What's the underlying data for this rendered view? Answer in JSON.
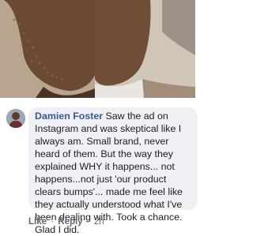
{
  "photo": {
    "before_alt": "",
    "after_alt": ""
  },
  "comment": {
    "author": "Damien Foster",
    "text": "Saw the ad on Instagram and was skeptical like I always am. Small brand, never heard of them. But the way they explained WHY it happens... not happens...not just 'our product clears bumps'... made me feel like they actually understood what I've been dealing with. Took a chance. Glad I did.",
    "actions": {
      "like": "Like",
      "separator": "·",
      "reply": "Reply",
      "separator2": "·",
      "time": "2h"
    }
  }
}
